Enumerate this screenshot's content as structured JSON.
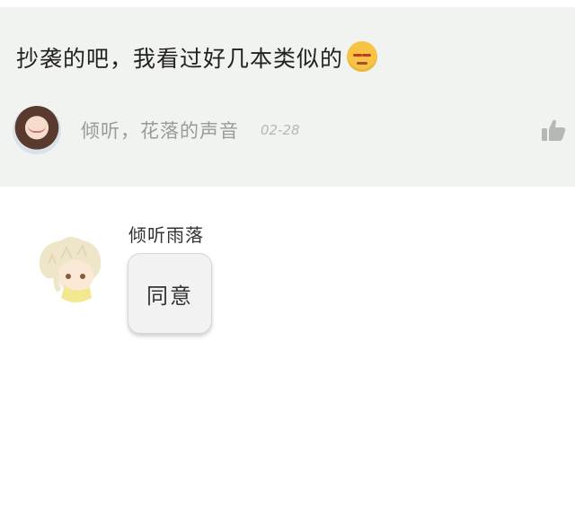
{
  "comment": {
    "text": "抄袭的吧，我看过好几本类似的",
    "emoji": "unamused-face-emoji",
    "author": "倾听，花落的声音",
    "date": "02-28",
    "like_icon": "thumbs-up-icon"
  },
  "reply": {
    "author": "倾听雨落",
    "message": "同意"
  },
  "colors": {
    "card_background": "#f0f3ef",
    "muted_text": "#9a9a9a",
    "emoji_yellow": "#f6c342"
  }
}
